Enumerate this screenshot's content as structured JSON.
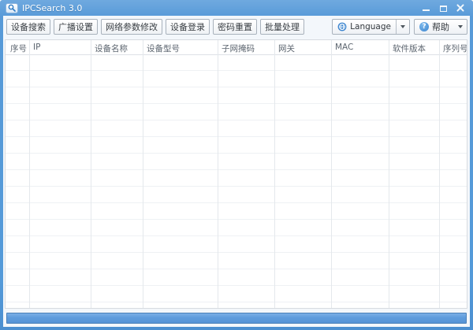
{
  "window": {
    "title": "IPCSearch 3.0"
  },
  "toolbar": {
    "buttons": [
      {
        "label": "设备搜索"
      },
      {
        "label": "广播设置"
      },
      {
        "label": "网络参数修改"
      },
      {
        "label": "设备登录"
      },
      {
        "label": "密码重置"
      },
      {
        "label": "批量处理"
      }
    ],
    "language_button": {
      "icon": "globe-icon",
      "label": "Language"
    },
    "help_button": {
      "icon": "question-circle-icon",
      "label": "帮助",
      "glyph": "?"
    }
  },
  "table": {
    "columns": [
      {
        "label": "序号"
      },
      {
        "label": "IP"
      },
      {
        "label": "设备名称"
      },
      {
        "label": "设备型号"
      },
      {
        "label": "子网掩码"
      },
      {
        "label": "网关"
      },
      {
        "label": "MAC"
      },
      {
        "label": "软件版本"
      },
      {
        "label": "序列号"
      }
    ],
    "rows": []
  },
  "statusbar": {
    "progress_percent": 100
  },
  "colors": {
    "titlebar_blue": "#579ad8",
    "window_border_blue": "#579ad8",
    "progress_fill_blue": "#5d9bdc",
    "progress_border_blue": "#4a80b8",
    "icon_accent_blue": "#3c85cf"
  },
  "icons": [
    "search-icon",
    "globe-icon",
    "question-circle-icon",
    "chevron-down-icon",
    "minimize-icon",
    "maximize-icon",
    "close-icon"
  ]
}
